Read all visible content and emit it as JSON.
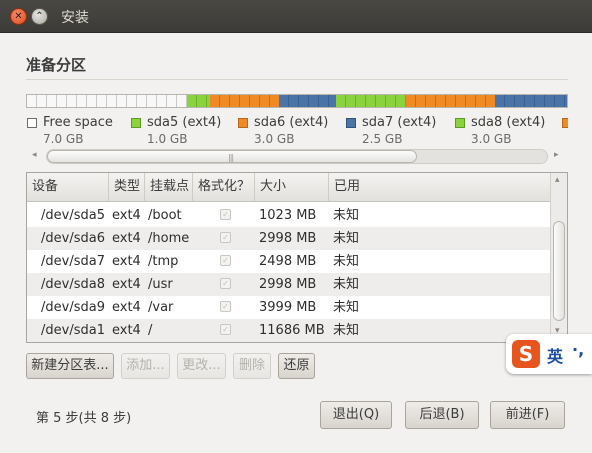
{
  "window": {
    "title": "安装"
  },
  "page": {
    "heading": "准备分区"
  },
  "partition_bar": {
    "segments": [
      {
        "kind": "free",
        "color": "#f8f8f8"
      },
      {
        "kind": "sda5",
        "color": "#8ad33f"
      },
      {
        "kind": "sda6",
        "color": "#f08a24"
      },
      {
        "kind": "sda7",
        "color": "#4a73a7"
      },
      {
        "kind": "sda8",
        "color": "#8ad33f"
      },
      {
        "kind": "sda9",
        "color": "#f08a24"
      },
      {
        "kind": "sda1",
        "color": "#4a73a7"
      }
    ]
  },
  "legend": [
    {
      "name": "Free space",
      "size": "7.0 GB",
      "color": "#ffffff"
    },
    {
      "name": "sda5 (ext4)",
      "size": "1.0 GB",
      "color": "#8ad33f"
    },
    {
      "name": "sda6 (ext4)",
      "size": "3.0 GB",
      "color": "#f08a24"
    },
    {
      "name": "sda7 (ext4)",
      "size": "2.5 GB",
      "color": "#4a73a7"
    },
    {
      "name": "sda8 (ext4)",
      "size": "3.0 GB",
      "color": "#8ad33f"
    },
    {
      "name": "",
      "size": "",
      "color": "#f08a24"
    }
  ],
  "table": {
    "columns": [
      "设备",
      "类型",
      "挂载点",
      "格式化？",
      "大小",
      "已用"
    ],
    "rows": [
      {
        "device": "/dev/sda5",
        "type": "ext4",
        "mount": "/boot",
        "size": "1023 MB",
        "used": "未知"
      },
      {
        "device": "/dev/sda6",
        "type": "ext4",
        "mount": "/home",
        "size": "2998 MB",
        "used": "未知"
      },
      {
        "device": "/dev/sda7",
        "type": "ext4",
        "mount": "/tmp",
        "size": "2498 MB",
        "used": "未知"
      },
      {
        "device": "/dev/sda8",
        "type": "ext4",
        "mount": "/usr",
        "size": "2998 MB",
        "used": "未知"
      },
      {
        "device": "/dev/sda9",
        "type": "ext4",
        "mount": "/var",
        "size": "3999 MB",
        "used": "未知"
      },
      {
        "device": "/dev/sda1",
        "type": "ext4",
        "mount": "/",
        "size": "11686 MB",
        "used": "未知"
      }
    ]
  },
  "actions": {
    "new_table": "新建分区表...",
    "add": "添加...",
    "change": "更改...",
    "delete": "删除",
    "revert": "还原"
  },
  "footer": {
    "step": "第 5 步(共 8 步)",
    "quit": "退出(Q)",
    "back": "后退(B)",
    "forward": "前进(F)"
  },
  "ime": {
    "logo": "S",
    "mode": "英",
    "punct": "·,"
  }
}
